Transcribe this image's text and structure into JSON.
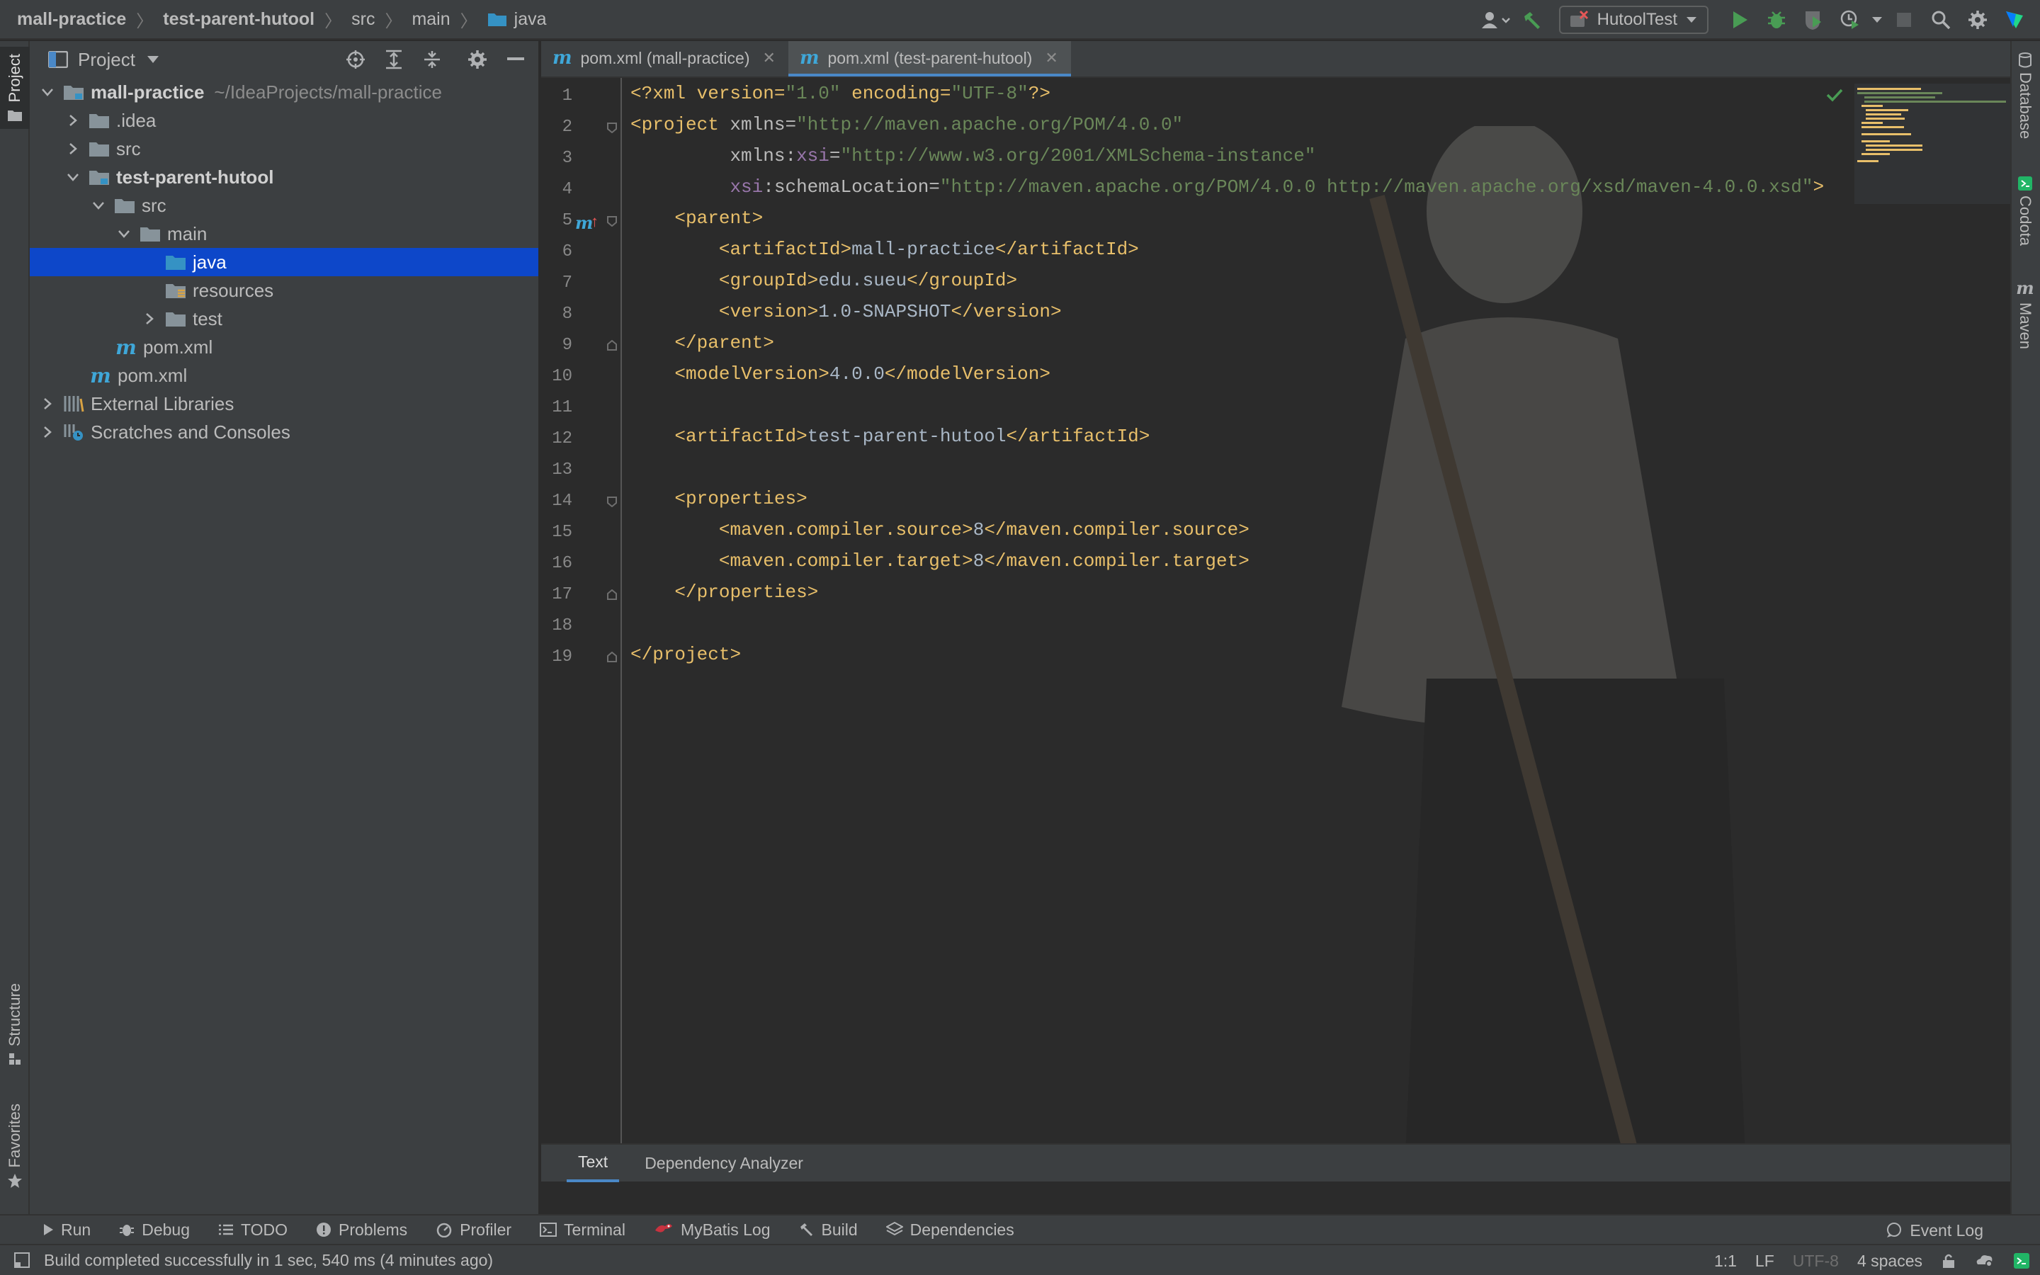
{
  "breadcrumb": {
    "items": [
      {
        "label": "mall-practice"
      },
      {
        "label": "test-parent-hutool"
      },
      {
        "label": "src"
      },
      {
        "label": "main"
      },
      {
        "label": "java"
      }
    ]
  },
  "toolbar": {
    "run_config": "HutoolTest"
  },
  "left_strip": {
    "project": "Project",
    "structure": "Structure",
    "favorites": "Favorites"
  },
  "right_strip": {
    "database": "Database",
    "codota": "Codota",
    "maven": "Maven"
  },
  "project_panel": {
    "title": "Project",
    "tree": [
      {
        "label": "mall-practice",
        "path": "~/IdeaProjects/mall-practice"
      },
      {
        "label": ".idea"
      },
      {
        "label": "src"
      },
      {
        "label": "test-parent-hutool"
      },
      {
        "label": "src"
      },
      {
        "label": "main"
      },
      {
        "label": "java"
      },
      {
        "label": "resources"
      },
      {
        "label": "test"
      },
      {
        "label": "pom.xml"
      },
      {
        "label": "pom.xml"
      },
      {
        "label": "External Libraries"
      },
      {
        "label": "Scratches and Consoles"
      }
    ]
  },
  "editor": {
    "tabs": [
      {
        "label": "pom.xml (mall-practice)"
      },
      {
        "label": "pom.xml (test-parent-hutool)"
      }
    ],
    "line_numbers": [
      "1",
      "2",
      "3",
      "4",
      "5",
      "6",
      "7",
      "8",
      "9",
      "10",
      "11",
      "12",
      "13",
      "14",
      "15",
      "16",
      "17",
      "18",
      "19"
    ],
    "code": {
      "l1": {
        "a": "<?",
        "b": "xml version",
        "c": "=",
        "d": "\"1.0\"",
        "e": " encoding",
        "f": "=",
        "g": "\"UTF-8\"",
        "h": "?>"
      },
      "l2": {
        "a": "<",
        "b": "project",
        "c": " xmlns",
        "d": "=",
        "e": "\"http://maven.apache.org/POM/4.0.0\""
      },
      "l3": {
        "indent": "         ",
        "a": "xmlns",
        "b": ":",
        "c": "xsi",
        "d": "=",
        "e": "\"http://www.w3.org/2001/XMLSchema-instance\""
      },
      "l4": {
        "indent": "         ",
        "a": "xsi",
        "b": ":",
        "c": "schemaLocation",
        "d": "=",
        "e": "\"http://maven.apache.org/POM/4.0.0 http://maven.apache.org/xsd/maven-4.0.0.xsd\"",
        "f": ">"
      },
      "l5": {
        "indent": "    ",
        "a": "<",
        "b": "parent",
        "c": ">"
      },
      "l6": {
        "indent": "        ",
        "a": "<",
        "b": "artifactId",
        "c": ">",
        "d": "mall-practice",
        "e": "</",
        "f": "artifactId",
        "g": ">"
      },
      "l7": {
        "indent": "        ",
        "a": "<",
        "b": "groupId",
        "c": ">",
        "d": "edu.sueu",
        "e": "</",
        "f": "groupId",
        "g": ">"
      },
      "l8": {
        "indent": "        ",
        "a": "<",
        "b": "version",
        "c": ">",
        "d": "1.0-SNAPSHOT",
        "e": "</",
        "f": "version",
        "g": ">"
      },
      "l9": {
        "indent": "    ",
        "a": "</",
        "b": "parent",
        "c": ">"
      },
      "l10": {
        "indent": "    ",
        "a": "<",
        "b": "modelVersion",
        "c": ">",
        "d": "4.0.0",
        "e": "</",
        "f": "modelVersion",
        "g": ">"
      },
      "l12": {
        "indent": "    ",
        "a": "<",
        "b": "artifactId",
        "c": ">",
        "d": "test-parent-hutool",
        "e": "</",
        "f": "artifactId",
        "g": ">"
      },
      "l14": {
        "indent": "    ",
        "a": "<",
        "b": "properties",
        "c": ">"
      },
      "l15": {
        "indent": "        ",
        "a": "<",
        "b": "maven.compiler.source",
        "c": ">",
        "d": "8",
        "e": "</",
        "f": "maven.compiler.source",
        "g": ">"
      },
      "l16": {
        "indent": "        ",
        "a": "<",
        "b": "maven.compiler.target",
        "c": ">",
        "d": "8",
        "e": "</",
        "f": "maven.compiler.target",
        "g": ">"
      },
      "l17": {
        "indent": "    ",
        "a": "</",
        "b": "properties",
        "c": ">"
      },
      "l19": {
        "a": "</",
        "b": "project",
        "c": ">"
      }
    },
    "bottom_tabs": [
      {
        "label": "Text"
      },
      {
        "label": "Dependency Analyzer"
      }
    ]
  },
  "tool_windows": [
    {
      "label": "Run"
    },
    {
      "label": "Debug"
    },
    {
      "label": "TODO"
    },
    {
      "label": "Problems"
    },
    {
      "label": "Profiler"
    },
    {
      "label": "Terminal"
    },
    {
      "label": "MyBatis Log"
    },
    {
      "label": "Build"
    },
    {
      "label": "Dependencies"
    }
  ],
  "event_log": "Event Log",
  "status": {
    "message": "Build completed successfully in 1 sec, 540 ms (4 minutes ago)",
    "position": "1:1",
    "line_sep": "LF",
    "encoding": "UTF-8",
    "indent": "4 spaces"
  },
  "colors": {
    "accent": "#4a88c7",
    "selection": "#0d47c9",
    "tag": "#e8bf6a",
    "string": "#6a8759",
    "namespace": "#9876aa",
    "run_green": "#499c54",
    "maven_blue": "#3fa7d8"
  }
}
